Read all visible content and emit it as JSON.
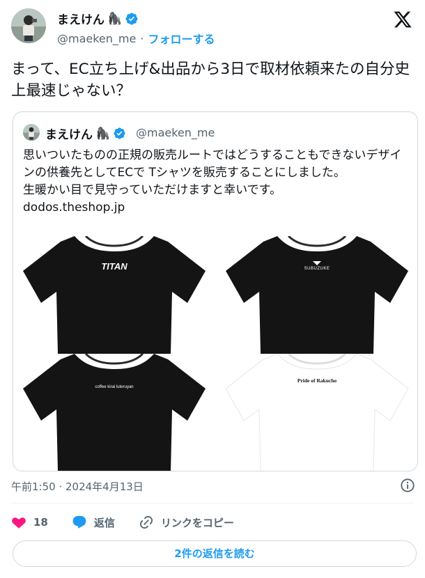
{
  "author": {
    "display_name": "まえけん",
    "emoji": "🦍",
    "handle": "@maeken_me",
    "separator": "·",
    "follow_label": "フォローする"
  },
  "tweet": {
    "text": "まって、EC立ち上げ&出品から3日で取材依頼来たの自分史上最速じゃない？",
    "timestamp": "午前1:50 · 2024年4月13日"
  },
  "quoted": {
    "display_name": "まえけん",
    "emoji": "🦍",
    "handle": "@maeken_me",
    "text": "思いついたものの正規の販売ルートではどうすることもできないデザインの供養先としてECで Tシャツを販売することにしました。\n生暖かい目で見守っていただけますと幸いです。\ndodos.theshop.jp",
    "media": [
      {
        "label": "TITAN",
        "shirt_color": "#141414"
      },
      {
        "label": "SUBUZUKE",
        "shirt_color": "#141414"
      },
      {
        "label": "coffee kirai luteruyan",
        "shirt_color": "#141414"
      },
      {
        "label": "Pride of Rakucho",
        "shirt_color": "#ffffff"
      }
    ]
  },
  "actions": {
    "likes_count": "18",
    "reply_label": "返信",
    "copy_link_label": "リンクをコピー"
  },
  "replies_button_label": "2件の返信を読む",
  "icons": {
    "verified": "verified-badge-icon",
    "x_logo": "x-logo-icon",
    "info": "info-icon",
    "heart": "heart-icon",
    "reply": "reply-bubble-icon",
    "link": "link-icon"
  },
  "colors": {
    "accent": "#1d9bf0",
    "like": "#f91880",
    "muted_text": "#536471",
    "border": "#cfd9de"
  }
}
